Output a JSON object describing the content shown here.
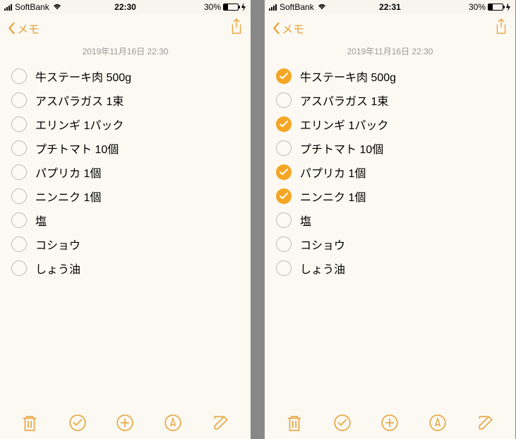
{
  "accent": "#e8a33d",
  "screens": [
    {
      "status": {
        "carrier": "SoftBank",
        "time": "22:30",
        "battery_pct": "30%"
      },
      "nav": {
        "back_label": "メモ"
      },
      "note_timestamp": "2019年11月16日 22:30",
      "items": [
        {
          "text": "牛ステーキ肉 500g",
          "checked": false
        },
        {
          "text": "アスパラガス 1束",
          "checked": false
        },
        {
          "text": "エリンギ 1パック",
          "checked": false
        },
        {
          "text": "プチトマト 10個",
          "checked": false
        },
        {
          "text": "パプリカ 1個",
          "checked": false
        },
        {
          "text": "ニンニク 1個",
          "checked": false
        },
        {
          "text": "塩",
          "checked": false
        },
        {
          "text": "コショウ",
          "checked": false
        },
        {
          "text": "しょう油",
          "checked": false
        }
      ]
    },
    {
      "status": {
        "carrier": "SoftBank",
        "time": "22:31",
        "battery_pct": "30%"
      },
      "nav": {
        "back_label": "メモ"
      },
      "note_timestamp": "2019年11月16日 22:30",
      "items": [
        {
          "text": "牛ステーキ肉 500g",
          "checked": true
        },
        {
          "text": "アスパラガス 1束",
          "checked": false
        },
        {
          "text": "エリンギ 1パック",
          "checked": true
        },
        {
          "text": "プチトマト 10個",
          "checked": false
        },
        {
          "text": "パプリカ 1個",
          "checked": true
        },
        {
          "text": "ニンニク 1個",
          "checked": true
        },
        {
          "text": "塩",
          "checked": false
        },
        {
          "text": "コショウ",
          "checked": false
        },
        {
          "text": "しょう油",
          "checked": false
        }
      ]
    }
  ]
}
